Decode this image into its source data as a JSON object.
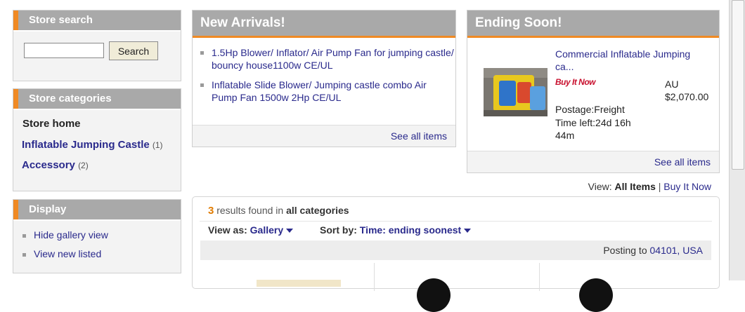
{
  "store_search": {
    "title": "Store search",
    "input_value": "",
    "button": "Search"
  },
  "store_categories": {
    "title": "Store categories",
    "home": "Store home",
    "items": [
      {
        "label": "Inflatable Jumping Castle",
        "count": "(1)"
      },
      {
        "label": "Accessory",
        "count": "(2)"
      }
    ]
  },
  "display": {
    "title": "Display",
    "items": [
      "Hide gallery view",
      "View new listed"
    ]
  },
  "new_arrivals": {
    "title": "New Arrivals!",
    "items": [
      "1.5Hp Blower/ Inflator/ Air Pump Fan for jumping castle/ bouncy house1100w CE/UL",
      "Inflatable Slide Blower/ Jumping castle combo Air Pump Fan 1500w 2Hp CE/UL"
    ],
    "see_all": "See all items"
  },
  "ending_soon": {
    "title": "Ending Soon!",
    "item_title": "Commercial Inflatable Jumping ca...",
    "buy_it_now": "Buy It Now",
    "currency": "AU",
    "price": "$2,070.00",
    "postage": "Postage:Freight",
    "time_left": "Time left:24d 16h 44m",
    "see_all": "See all items"
  },
  "view_bar": {
    "prefix": "View:",
    "all_items": "All Items",
    "sep": "|",
    "buy_it_now": "Buy It Now"
  },
  "results": {
    "count": "3",
    "found_text": "results found in",
    "scope": "all categories",
    "view_as_label": "View as:",
    "view_as_value": "Gallery",
    "sort_label": "Sort by:",
    "sort_value": "Time: ending soonest",
    "posting_label": "Posting to",
    "posting_value": "04101, USA"
  },
  "colors": {
    "accent": "#f08a24",
    "header_gray": "#a9a9a9",
    "link": "#2a2a8c",
    "count_orange": "#e07b00"
  }
}
